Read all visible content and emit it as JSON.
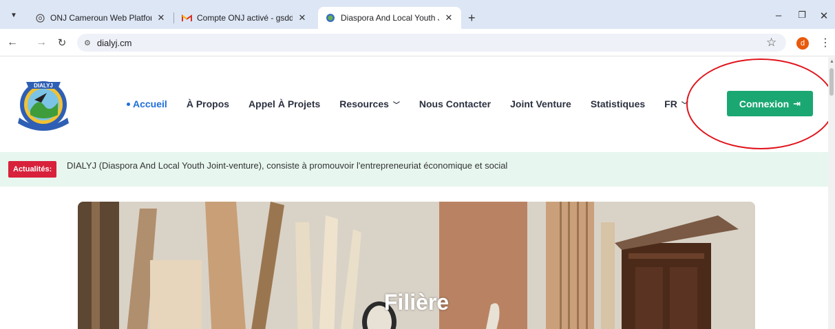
{
  "browser": {
    "tabs": [
      {
        "title": "ONJ Cameroun Web Platform",
        "favicon": "globe-icon"
      },
      {
        "title": "Compte ONJ activé - gsddialyj@",
        "favicon": "gmail-icon"
      },
      {
        "title": "Diaspora And Local Youth Joint",
        "favicon": "site-logo-icon"
      }
    ],
    "url": "dialyj.cm",
    "profile_initial": "d"
  },
  "header": {
    "logo_text": "DIALYJ",
    "nav": [
      {
        "label": "Accueil",
        "active": true
      },
      {
        "label": "À Propos"
      },
      {
        "label": "Appel À Projets"
      },
      {
        "label": "Resources",
        "dropdown": true
      },
      {
        "label": "Nous Contacter"
      },
      {
        "label": "Joint Venture"
      },
      {
        "label": "Statistiques"
      },
      {
        "label": "FR",
        "dropdown": true
      }
    ],
    "login_label": "Connexion"
  },
  "news": {
    "badge": "Actualités:",
    "text": "DIALYJ (Diaspora And Local Youth Joint-venture), consiste à promouvoir l'entrepreneuriat économique et social"
  },
  "hero": {
    "title": "Filière"
  },
  "colors": {
    "accent": "#1e6fd9",
    "login": "#1aa772",
    "badge": "#d8213b",
    "annotation": "#e0131b"
  }
}
